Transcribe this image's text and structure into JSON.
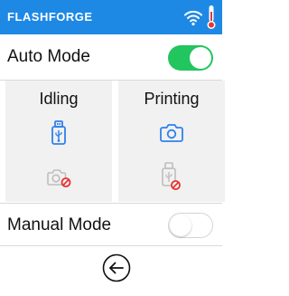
{
  "header": {
    "brand": "FLASHFORGE",
    "background_color": "#1E88E5",
    "icons": [
      "wifi-icon",
      "thermometer-icon"
    ]
  },
  "auto_mode": {
    "label": "Auto Mode",
    "toggle_on": true,
    "toggle_color": "#22C55E"
  },
  "panels": {
    "idling": {
      "title": "Idling",
      "primary_icon": "usb-icon",
      "primary_color": "#2F80ED",
      "secondary_icon": "camera-disabled-icon"
    },
    "printing": {
      "title": "Printing",
      "primary_icon": "camera-icon",
      "primary_color": "#2F80ED",
      "secondary_icon": "usb-disabled-icon"
    },
    "disabled_badge_color": "#E53935"
  },
  "manual_mode": {
    "label": "Manual Mode",
    "toggle_on": false
  },
  "footer": {
    "back_icon": "back-arrow-icon"
  }
}
